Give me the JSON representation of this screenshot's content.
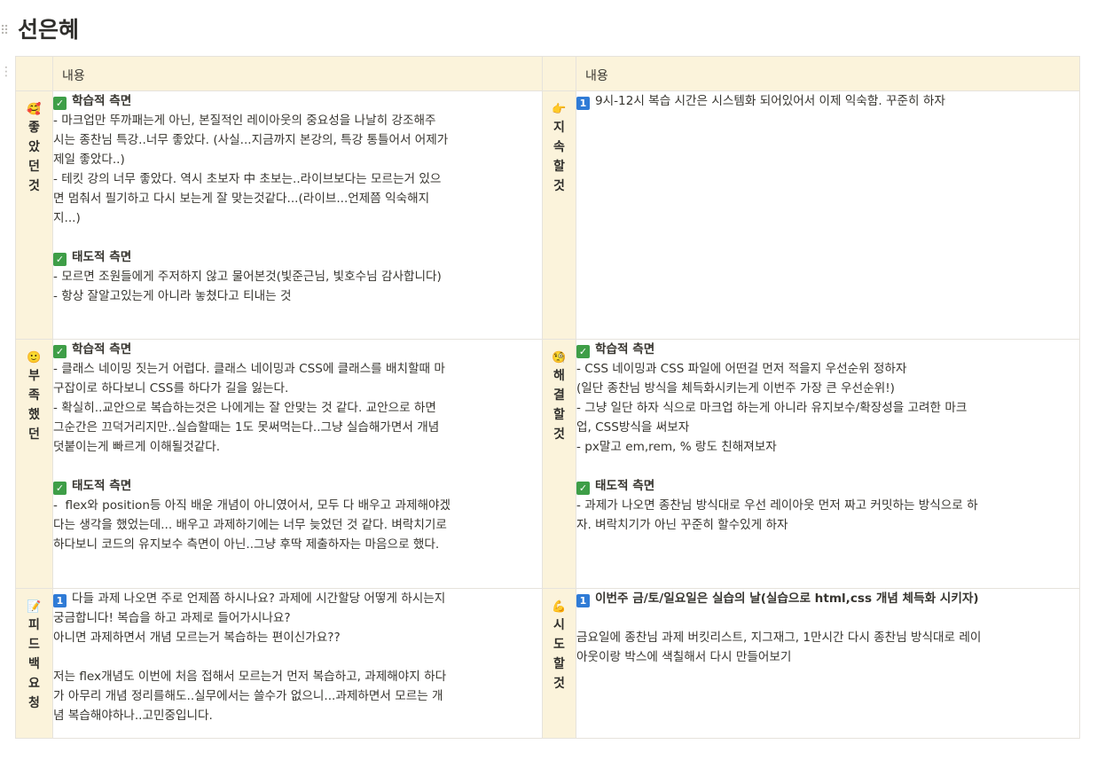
{
  "page": {
    "title": "선은혜"
  },
  "table": {
    "header": {
      "col2": "내용",
      "col4": "내용"
    },
    "rows": [
      {
        "left": {
          "emoji": "🥰",
          "label": [
            "좋",
            "았",
            "던",
            "것"
          ],
          "lines": [
            {
              "type": "check-head",
              "text": "학습적 측면"
            },
            {
              "type": "text",
              "text": "- 마크업만 뚜까패는게 아닌, 본질적인 레이아웃의 중요성을 나날히 강조해주"
            },
            {
              "type": "text",
              "text": "시는 종찬님 특강..너무 좋았다. (사실...지금까지 본강의, 특강 통틀어서 어제가"
            },
            {
              "type": "text",
              "text": "제일 좋았다..)"
            },
            {
              "type": "text",
              "text": "- 테킷 강의 너무 좋았다. 역시 초보자 中 초보는..라이브보다는 모르는거 있으"
            },
            {
              "type": "text",
              "text": "면 멈춰서 필기하고 다시 보는게 잘 맞는것같다...(라이브...언제쯤 익숙해지"
            },
            {
              "type": "text",
              "text": "지...)"
            },
            {
              "type": "blank"
            },
            {
              "type": "check-head",
              "text": "태도적 측면"
            },
            {
              "type": "text",
              "text": "- 모르면 조원들에게 주저하지 않고 물어본것(빛준근님, 빛호수님 감사합니다)"
            },
            {
              "type": "text",
              "text": "- 항상 잘알고있는게 아니라 놓쳤다고 티내는 것"
            }
          ]
        },
        "right": {
          "emoji": "👉",
          "label": [
            "지",
            "속",
            "할",
            "것"
          ],
          "lines": [
            {
              "type": "num-text",
              "num": "1",
              "text": "9시-12시 복습 시간은 시스템화 되어있어서 이제 익숙함. 꾸준히 하자"
            }
          ]
        }
      },
      {
        "left": {
          "emoji": "🙂",
          "label": [
            "부",
            "족",
            "했",
            "던"
          ],
          "lines": [
            {
              "type": "check-head",
              "text": "학습적 측면"
            },
            {
              "type": "text",
              "text": "- 클래스 네이밍 짓는거 어렵다. 클래스 네이밍과 CSS에 클래스를 배치할때 마"
            },
            {
              "type": "text",
              "text": "구잡이로 하다보니 CSS를 하다가 길을 잃는다."
            },
            {
              "type": "text",
              "text": "- 확실히..교안으로 복습하는것은 나에게는 잘 안맞는 것 같다. 교안으로 하면"
            },
            {
              "type": "text",
              "text": "그순간은 끄덕거리지만..실습할때는 1도 못써먹는다..그냥 실습해가면서 개념"
            },
            {
              "type": "text",
              "text": "덧붙이는게 빠르게 이해될것같다."
            },
            {
              "type": "blank"
            },
            {
              "type": "check-head",
              "text": "태도적 측면"
            },
            {
              "type": "text",
              "text": "-  flex와 position등 아직 배운 개념이 아니였어서, 모두 다 배우고 과제해야겠"
            },
            {
              "type": "text",
              "text": "다는 생각을 했었는데... 배우고 과제하기에는 너무 늦었던 것 같다. 벼락치기로"
            },
            {
              "type": "text",
              "text": "하다보니 코드의 유지보수 측면이 아닌..그냥 후딱 제출하자는 마음으로 했다."
            }
          ]
        },
        "right": {
          "emoji": "🧐",
          "label": [
            "해",
            "결",
            "할",
            "것"
          ],
          "lines": [
            {
              "type": "check-head",
              "text": "학습적 측면"
            },
            {
              "type": "text",
              "text": "- CSS 네이밍과 CSS 파일에 어떤걸 먼저 적을지 우선순위 정하자"
            },
            {
              "type": "text",
              "text": "(일단 종찬님 방식을 체득화시키는게 이번주 가장 큰 우선순위!)"
            },
            {
              "type": "text",
              "text": "- 그냥 일단 하자 식으로 마크업 하는게 아니라 유지보수/확장성을 고려한 마크"
            },
            {
              "type": "text",
              "text": "업, CSS방식을 써보자"
            },
            {
              "type": "text",
              "text": "- px말고 em,rem, % 랑도 친해져보자"
            },
            {
              "type": "blank"
            },
            {
              "type": "check-head",
              "text": "태도적 측면"
            },
            {
              "type": "text",
              "text": "- 과제가 나오면 종찬님 방식대로 우선 레이아웃 먼저 짜고 커밋하는 방식으로 하"
            },
            {
              "type": "text",
              "text": "자. 벼락치기가 아닌 꾸준히 할수있게 하자"
            }
          ]
        }
      },
      {
        "left": {
          "emoji": "📝",
          "label": [
            "피",
            "드",
            "백",
            "요",
            "청"
          ],
          "lines": [
            {
              "type": "num-text",
              "num": "1",
              "text": "다들 과제 나오면 주로 언제쯤 하시나요? 과제에 시간할당 어떻게 하시는지"
            },
            {
              "type": "text",
              "text": "궁금합니다! 복습을 하고 과제로 들어가시나요?"
            },
            {
              "type": "text",
              "text": "아니면 과제하면서 개념 모르는거 복습하는 편이신가요??"
            },
            {
              "type": "blank"
            },
            {
              "type": "text",
              "text": "저는 flex개념도 이번에 처음 접해서 모르는거 먼저 복습하고, 과제해야지 하다"
            },
            {
              "type": "text",
              "text": "가 아무리 개념 정리를해도..실무에서는 쓸수가 없으니...과제하면서 모르는 개"
            },
            {
              "type": "text",
              "text": "념 복습해야하나..고민중입니다."
            }
          ]
        },
        "right": {
          "emoji": "💪",
          "label": [
            "시",
            "도",
            "할",
            "것"
          ],
          "lines": [
            {
              "type": "num-head",
              "num": "1",
              "text": "이번주 금/토/일요일은 실습의 날(실습으로 html,css 개념 체득화 시키자)"
            },
            {
              "type": "blank"
            },
            {
              "type": "text",
              "text": "금요일에 종찬님 과제 버킷리스트, 지그재그, 1만시간 다시 종찬님 방식대로 레이"
            },
            {
              "type": "text",
              "text": "아웃이랑 박스에 색칠해서 다시 만들어보기"
            }
          ]
        }
      }
    ]
  }
}
